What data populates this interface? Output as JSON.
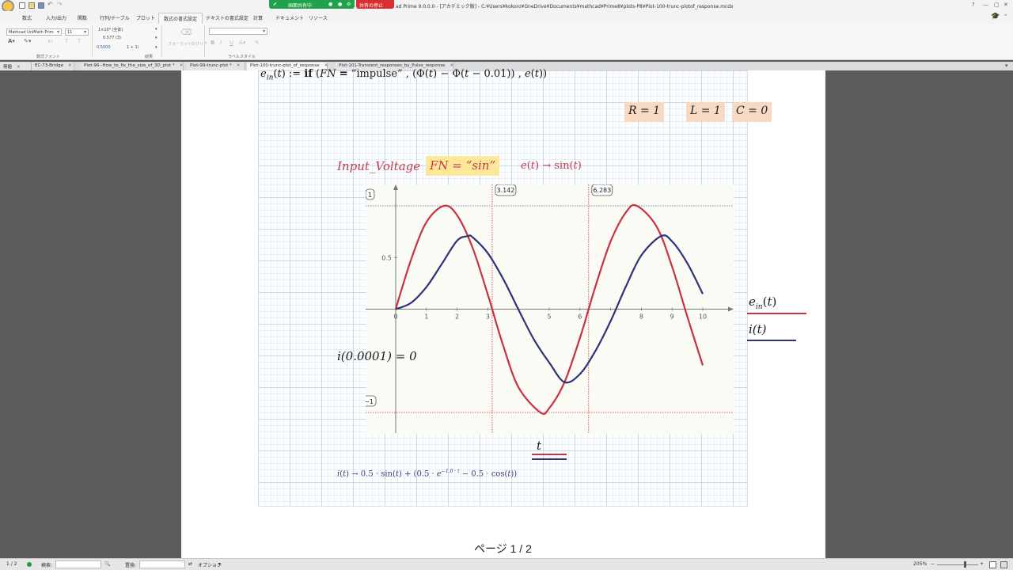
{
  "app": {
    "window_title": "ad Prime 9.0.0.0 - [アカデミック版] - C:¥Users¥kokoro¥OneDrive¥Documents¥mathcad¥Prime8¥plots-P8¥Plot-100-trunc-plotof_response.mcdx",
    "share_active": "画面共有中",
    "share_stop": "共有の停止"
  },
  "ribbon_tabs": [
    "数式",
    "入力/出力",
    "関数",
    "行列/テーブル",
    "プロット",
    "数式の書式設定",
    "テキストの書式設定",
    "計算",
    "ドキュメント",
    "リソース"
  ],
  "ribbon_active_tab": "数式の書式設定",
  "ribbon": {
    "font_name": "Mathcad UniMath Prim",
    "font_size": "11",
    "result_format_1": "1×10⁹ (全体)",
    "result_format_2": "0.577 (3)",
    "result_format_3": "0.5000",
    "complex_format": "1 + 1i",
    "format_paint": "フォーマットのクリア",
    "group_font": "数式フォント",
    "group_result": "結果",
    "group_label_style": "ラベルスタイル"
  },
  "doc_tabs": [
    {
      "label": "無題"
    },
    {
      "label": "EC-73-Bridge"
    },
    {
      "label": "Plot-96--How_to_fix_the_size_of_3D_plot *"
    },
    {
      "label": "Plot-99-trunc-plot *"
    },
    {
      "label": "Plot-100-trunc-plot_of_response"
    },
    {
      "label": "Plot-101-Transient_responses_by_Pulse_response"
    }
  ],
  "doc": {
    "params": {
      "R": "R = 1",
      "L": "L = 1",
      "C": "C = 0"
    },
    "input_voltage": "Input_Voltage",
    "fn_value": "FN = “sin”",
    "i_eq": "i(0.0001) = 0",
    "x_label": "t",
    "legend_ein": "e",
    "legend_ein_sub": "in",
    "legend_i": "i(t)",
    "page_footer": "ページ 1 / 2"
  },
  "chart_data": {
    "type": "line",
    "title": "",
    "xlabel": "t",
    "ylabel": "",
    "xlim": [
      0,
      10
    ],
    "ylim": [
      -1,
      1
    ],
    "x_ticks": [
      0,
      1,
      2,
      3,
      4,
      5,
      6,
      7,
      8,
      9,
      10
    ],
    "x_tick_labels": [
      "0",
      "1",
      "2",
      "3",
      "",
      "5",
      "6",
      "",
      "8",
      "9",
      "10"
    ],
    "y_ticks": [
      0.5
    ],
    "y_tick_labels": [
      "0.5"
    ],
    "y_max_label": "1",
    "y_min_label": "−1",
    "markers_x": [
      {
        "value": 3.142,
        "label": "3.142"
      },
      {
        "value": 6.283,
        "label": "6.283"
      }
    ],
    "markers_y": [
      1,
      -1
    ],
    "series": [
      {
        "name": "e_in(t)",
        "color": "#c8323e",
        "x": [
          0,
          0.5,
          1,
          1.571,
          2,
          2.5,
          3,
          3.142,
          3.5,
          4,
          4.712,
          5,
          5.5,
          6,
          6.283,
          6.5,
          7,
          7.5,
          7.854,
          8.5,
          9,
          9.5,
          10
        ],
        "y": [
          0,
          0.479,
          0.841,
          1,
          0.909,
          0.598,
          0.141,
          0,
          -0.351,
          -0.757,
          -1,
          -0.959,
          -0.706,
          -0.279,
          0,
          0.215,
          0.657,
          0.938,
          1,
          0.798,
          0.412,
          -0.075,
          -0.544
        ]
      },
      {
        "name": "i(t)",
        "color": "#2e3278",
        "x": [
          0,
          0.5,
          1,
          1.5,
          2,
          2.356,
          2.5,
          3,
          3.5,
          4,
          4.5,
          5,
          5.498,
          6,
          6.5,
          7,
          7.5,
          8,
          8.639,
          9,
          9.5,
          10
        ],
        "y": [
          0,
          0.061,
          0.214,
          0.437,
          0.663,
          0.707,
          0.697,
          0.542,
          0.293,
          -0.005,
          -0.293,
          -0.517,
          -0.707,
          -0.628,
          -0.407,
          -0.115,
          0.222,
          0.521,
          0.707,
          0.656,
          0.443,
          0.147
        ]
      }
    ],
    "legend": "right",
    "grid": false
  },
  "status": {
    "page": "1 / 2",
    "search": "検索:",
    "replace": "置換:",
    "options": "オプション",
    "zoom": "205%"
  }
}
